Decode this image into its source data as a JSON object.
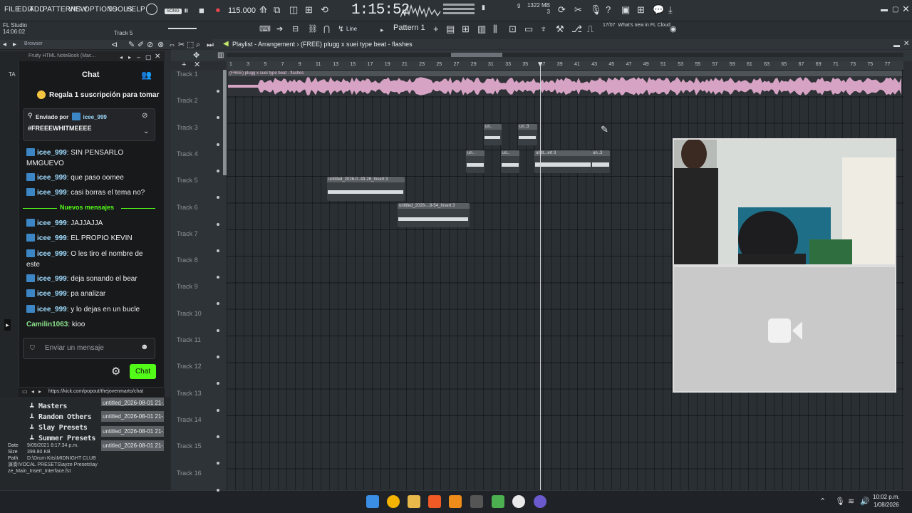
{
  "menu": [
    "FILE",
    "EDIT",
    "ADD",
    "PATTERNS",
    "VIEW",
    "OPTIONS",
    "TOOLS",
    "HELP"
  ],
  "transport": {
    "song_badge": "SONG",
    "bpm": "115.000",
    "time": "1:15:52",
    "cpu_mem": "1322 MB",
    "cpu_num": "3",
    "cpu_small": "9"
  },
  "status": {
    "app": "FL Studio",
    "elapsed": "14:06:02",
    "track_label": "Track 5",
    "pattern": "Pattern 1",
    "snap": "Line",
    "news_date": "17/07",
    "news_text": "What's new in FL Cloud"
  },
  "browser": {
    "label": "Browser",
    "folders": [
      "Masters",
      "Random Others",
      "Slay Presets",
      "Summer Presets"
    ],
    "file_info": {
      "date_label": "Date",
      "date": "9/09/2021 8:17:34 p.m.",
      "size_label": "Size",
      "size": "399.80 KB",
      "path_label": "Path",
      "path": "D:\\Drum Kits\\MIDNIGHT CLUB 演奏\\VOCAL PRESETS\\ayze Presets\\ayze_Main_Insert_Interface.fst"
    }
  },
  "chat": {
    "window_title": "Fruity HTML NoteBook (Mac...",
    "title": "Chat",
    "sub_banner": "Regala 1 suscripción para tomar",
    "pinned_by_label": "Enviado por",
    "pinned_user": "icee_999",
    "pinned_text": "#FREEEWHITMEEEE",
    "messages": [
      {
        "user": "icee_999",
        "text": "SIN PENSARLO MMGUEVO"
      },
      {
        "user": "icee_999",
        "text": "que paso oomee"
      },
      {
        "user": "icee_999",
        "text": "casi borras el tema no?"
      }
    ],
    "new_label": "Nuevos mensajes",
    "new_messages": [
      {
        "user": "icee_999",
        "text": "JAJJAJJA"
      },
      {
        "user": "icee_999",
        "text": "EL PROPIO KEVIN"
      },
      {
        "user": "icee_999",
        "text": "O les tiro el nombre de este"
      },
      {
        "user": "icee_999",
        "text": "deja sonando el bear"
      },
      {
        "user": "icee_999",
        "text": "pa analizar"
      },
      {
        "user": "icee_999",
        "text": "y lo dejas en un bucle"
      },
      {
        "user": "Camilin1063",
        "text": "kioo"
      }
    ],
    "input_placeholder": "Enviar un mensaje",
    "send_label": "Chat",
    "url": "https://kick.com/popout/thejovenmarto/chat"
  },
  "playlist": {
    "title": "Playlist - Arrangement › (FREE) plugg x suei type beat - flashes",
    "ruler": [
      "1",
      "3",
      "5",
      "7",
      "9",
      "11",
      "13",
      "15",
      "17",
      "19",
      "21",
      "23",
      "25",
      "27",
      "29",
      "31",
      "33",
      "35",
      "37",
      "39",
      "41",
      "43",
      "45",
      "47",
      "49",
      "51",
      "53",
      "55",
      "57",
      "59",
      "61",
      "63",
      "65",
      "67",
      "69",
      "71",
      "73",
      "75",
      "77"
    ],
    "tracks": [
      "Track 1",
      "Track 2",
      "Track 3",
      "Track 4",
      "Track 5",
      "Track 6",
      "Track 7",
      "Track 8",
      "Track 9",
      "Track 10",
      "Track 11",
      "Track 12",
      "Track 13",
      "Track 14",
      "Track 15",
      "Track 16"
    ],
    "clips": [
      {
        "label": "(FREE) plugg x suei type beat - flashes"
      },
      {
        "label": "un.."
      },
      {
        "label": "un..3"
      },
      {
        "label": "un.."
      },
      {
        "label": "un.."
      },
      {
        "label": "untit...ert 3"
      },
      {
        "label": "un..3"
      },
      {
        "label": "untitled_2026-0..43-26_Insert 3"
      },
      {
        "label": "untitled_2026-...8-54_Insert 3"
      }
    ],
    "pattern_items": [
      "untitled_2026-08-01 21-...",
      "untitled_2026-08-01 21-...",
      "untitled_2026-08-01 21-...",
      "untitled_2026-08-01 21-..."
    ]
  },
  "taskbar": {
    "time": "10:02 p.m.",
    "date": "1/08/2026"
  },
  "colors": {
    "accent_green": "#53fc18",
    "clip_pink": "#d7a3c4",
    "grid_bg": "#2a2f33"
  }
}
